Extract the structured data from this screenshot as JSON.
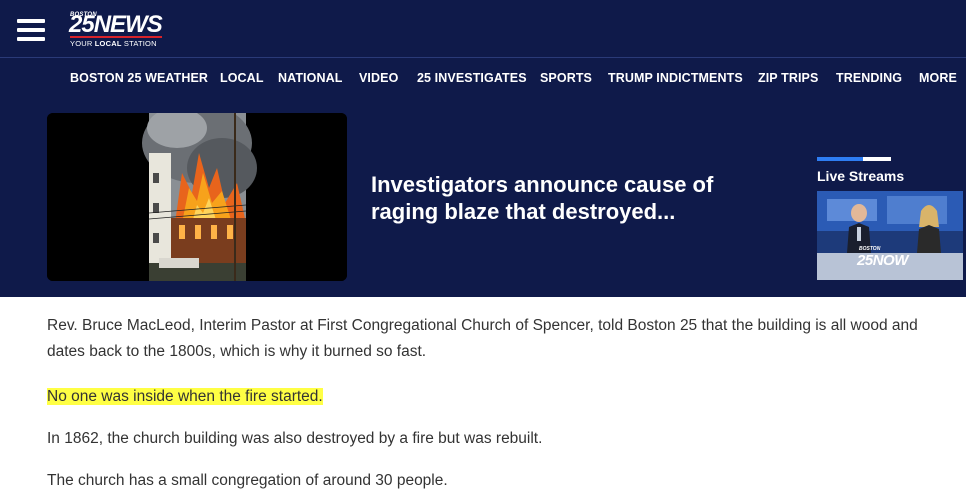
{
  "header": {
    "menu_icon": "hamburger-menu-icon",
    "logo": {
      "small_text": "BOSTON",
      "number": "25",
      "word": "NEWS",
      "tagline_prefix": "YOUR",
      "tagline_bold": "LOCAL",
      "tagline_suffix": "STATION",
      "brand_color": "#0f1a4a",
      "accent_color": "#d8232a"
    }
  },
  "nav": {
    "items": [
      {
        "label": "BOSTON 25 WEATHER"
      },
      {
        "label": "LOCAL"
      },
      {
        "label": "NATIONAL"
      },
      {
        "label": "VIDEO"
      },
      {
        "label": "25 INVESTIGATES"
      },
      {
        "label": "SPORTS"
      },
      {
        "label": "TRUMP INDICTMENTS"
      },
      {
        "label": "ZIP TRIPS"
      },
      {
        "label": "TRENDING"
      },
      {
        "label": "MORE"
      }
    ]
  },
  "hero": {
    "headline": "Investigators announce cause of raging blaze that destroyed...",
    "image_description": "church-fire-photo"
  },
  "live_streams": {
    "title": "Live Streams",
    "thumb_logo_small": "BOSTON",
    "thumb_logo_number": "25",
    "thumb_logo_word": "NOW",
    "accent_color": "#2e7df2"
  },
  "article": {
    "paragraphs": [
      "Rev. Bruce MacLeod, Interim Pastor at First Congregational Church of Spencer, told Boston 25 that the building is all wood and dates back to the 1800s, which is why it burned so fast.",
      "No one was inside when the fire started.",
      "In 1862, the church building was also destroyed by a fire but was rebuilt.",
      "The church has a small congregation of around 30 people."
    ],
    "highlight_color": "#ffff44"
  }
}
